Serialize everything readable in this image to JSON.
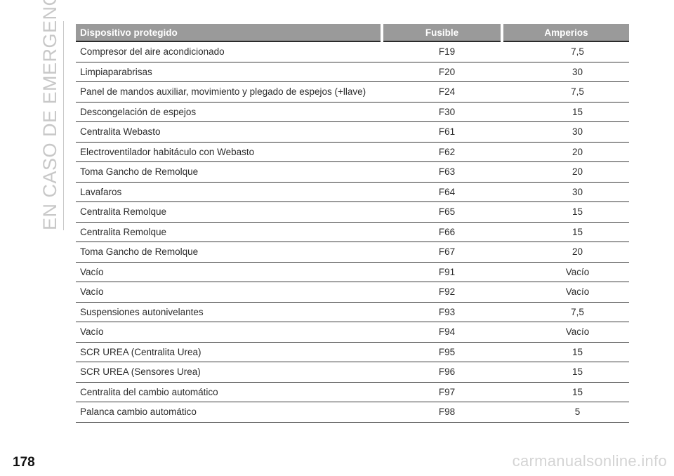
{
  "section_title": "EN CASO DE EMERGENCIA",
  "table": {
    "headers": [
      "Dispositivo protegido",
      "Fusible",
      "Amperios"
    ],
    "rows": [
      [
        "Compresor del aire acondicionado",
        "F19",
        "7,5"
      ],
      [
        "Limpiaparabrisas",
        "F20",
        "30"
      ],
      [
        "Panel de mandos auxiliar, movimiento y plegado de espejos (+llave)",
        "F24",
        "7,5"
      ],
      [
        "Descongelación de espejos",
        "F30",
        "15"
      ],
      [
        "Centralita Webasto",
        "F61",
        "30"
      ],
      [
        "Electroventilador habitáculo con Webasto",
        "F62",
        "20"
      ],
      [
        "Toma Gancho de Remolque",
        "F63",
        "20"
      ],
      [
        "Lavafaros",
        "F64",
        "30"
      ],
      [
        "Centralita Remolque",
        "F65",
        "15"
      ],
      [
        "Centralita Remolque",
        "F66",
        "15"
      ],
      [
        "Toma Gancho de Remolque",
        "F67",
        "20"
      ],
      [
        "Vacío",
        "F91",
        "Vacío"
      ],
      [
        "Vacío",
        "F92",
        "Vacío"
      ],
      [
        "Suspensiones autonivelantes",
        "F93",
        "7,5"
      ],
      [
        "Vacío",
        "F94",
        "Vacío"
      ],
      [
        "SCR UREA (Centralita Urea)",
        "F95",
        "15"
      ],
      [
        "SCR UREA (Sensores Urea)",
        "F96",
        "15"
      ],
      [
        "Centralita del cambio automático",
        "F97",
        "15"
      ],
      [
        "Palanca cambio automático",
        "F98",
        "5"
      ]
    ]
  },
  "page_number": "178",
  "watermark": "carmanualsonline.info"
}
